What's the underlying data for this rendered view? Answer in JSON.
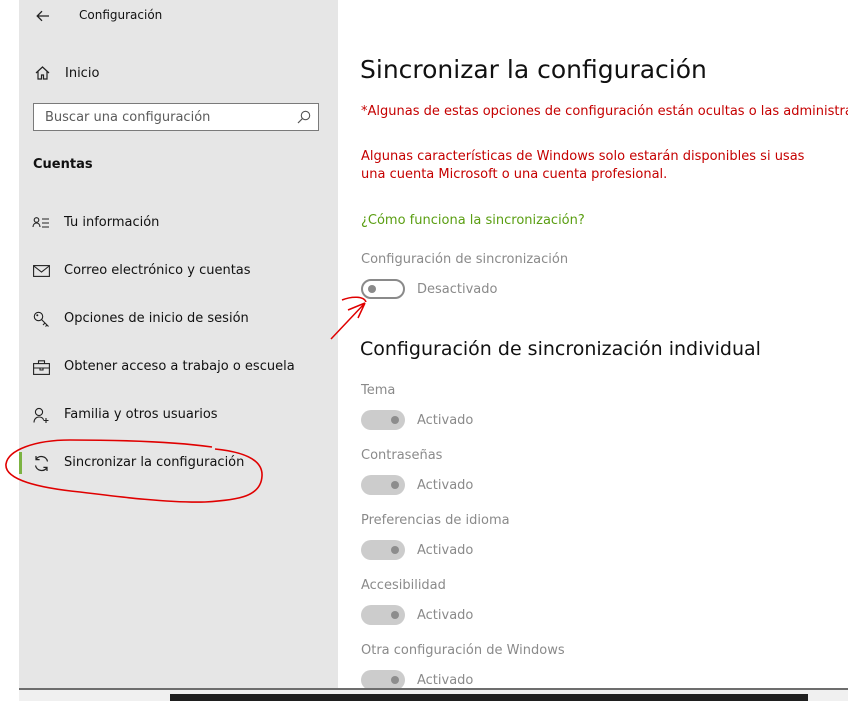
{
  "window": {
    "title": "Configuración"
  },
  "sidebar": {
    "home_label": "Inicio",
    "search": {
      "placeholder": "Buscar una configuración"
    },
    "section_title": "Cuentas",
    "items": [
      {
        "label": "Tu información",
        "icon": "person-card-icon"
      },
      {
        "label": "Correo electrónico y cuentas",
        "icon": "mail-icon"
      },
      {
        "label": "Opciones de inicio de sesión",
        "icon": "key-icon"
      },
      {
        "label": "Obtener acceso a trabajo o escuela",
        "icon": "briefcase-icon"
      },
      {
        "label": "Familia y otros usuarios",
        "icon": "person-add-icon"
      },
      {
        "label": "Sincronizar la configuración",
        "icon": "sync-icon",
        "active": true
      }
    ]
  },
  "main": {
    "title": "Sincronizar la configuración",
    "warning_hidden": "*Algunas de estas opciones de configuración están ocultas o las administra la c",
    "warning_account": "Algunas características de Windows solo estarán disponibles si usas una cuenta Microsoft o una cuenta profesional.",
    "help_link": "¿Cómo funciona la sincronización?",
    "sync_setting": {
      "label": "Configuración de sincronización",
      "state": "Desactivado"
    },
    "individual_title": "Configuración de sincronización individual",
    "individual": [
      {
        "label": "Tema",
        "state": "Activado"
      },
      {
        "label": "Contraseñas",
        "state": "Activado"
      },
      {
        "label": "Preferencias de idioma",
        "state": "Activado"
      },
      {
        "label": "Accesibilidad",
        "state": "Activado"
      },
      {
        "label": "Otra configuración de Windows",
        "state": "Activado"
      }
    ]
  },
  "colors": {
    "warning": "#c50000",
    "link": "#5a9e12",
    "accent_bar": "#7cb342",
    "annotation": "#e00000"
  }
}
